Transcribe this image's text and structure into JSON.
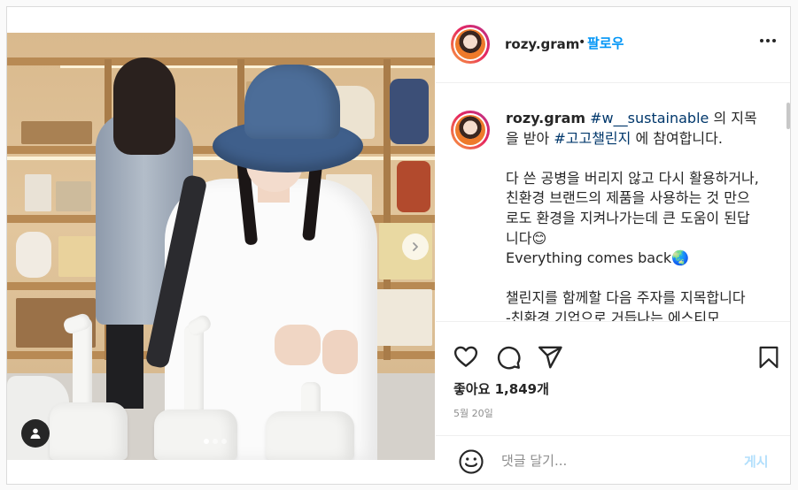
{
  "post": {
    "username": "rozy.gram",
    "follow_separator": "•",
    "follow_label": "팔로우",
    "caption": {
      "author": "rozy.gram",
      "hashtag1": "#w__sustainable",
      "text1": " 의 지목을 받아 ",
      "hashtag2": "#고고챌린지",
      "text2": " 에 참여합니다.\n\n다 쓴 공병을 버리지 않고 다시 활용하거나, 친환경 브랜드의 제품을 사용하는 것 만으로도 환경을 지켜나가는데 큰 도움이 된답니다😊\nEverything comes back🌏\n\n챌린지를 함께할 다음 주자를 지목합니다\n-친환경 기업으로 거듭나는 에스티모"
    },
    "likes": "좋아요 1,849개",
    "date": "5월 20일",
    "carousel": {
      "slides": 3,
      "active": 1
    }
  },
  "comment": {
    "placeholder": "댓글 달기...",
    "post_label": "게시"
  },
  "icons": [
    "more-icon",
    "heart-icon",
    "comment-icon",
    "share-icon",
    "bookmark-icon",
    "emoji-icon",
    "chevron-right-icon",
    "user-tag-icon"
  ]
}
